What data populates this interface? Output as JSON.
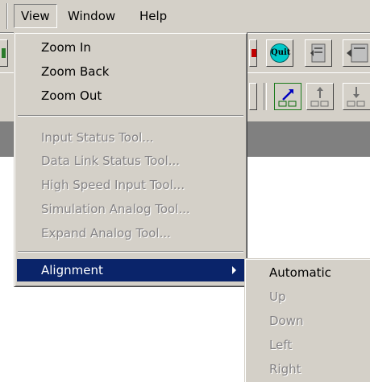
{
  "menubar": {
    "items": [
      {
        "label": "View",
        "open": true
      },
      {
        "label": "Window"
      },
      {
        "label": "Help"
      }
    ]
  },
  "toolbar": {
    "quit_label": "Quit"
  },
  "view_menu": {
    "items": [
      {
        "label": "Zoom In",
        "enabled": true
      },
      {
        "label": "Zoom Back",
        "enabled": true
      },
      {
        "label": "Zoom Out",
        "enabled": true
      },
      {
        "label": "Input Status Tool...",
        "enabled": false
      },
      {
        "label": "Data Link Status Tool...",
        "enabled": false
      },
      {
        "label": "High Speed Input Tool...",
        "enabled": false
      },
      {
        "label": "Simulation Analog Tool...",
        "enabled": false
      },
      {
        "label": "Expand Analog Tool...",
        "enabled": false
      },
      {
        "label": "Alignment",
        "enabled": true,
        "highlighted": true,
        "has_submenu": true
      }
    ]
  },
  "alignment_submenu": {
    "items": [
      {
        "label": "Automatic",
        "enabled": true
      },
      {
        "label": "Up",
        "enabled": false
      },
      {
        "label": "Down",
        "enabled": false
      },
      {
        "label": "Left",
        "enabled": false
      },
      {
        "label": "Right",
        "enabled": false
      }
    ]
  },
  "colors": {
    "face": "#d4d0c8",
    "highlight": "#0a246a",
    "disabled_text": "#848284",
    "workspace": "#ffffff",
    "band": "#808080"
  }
}
